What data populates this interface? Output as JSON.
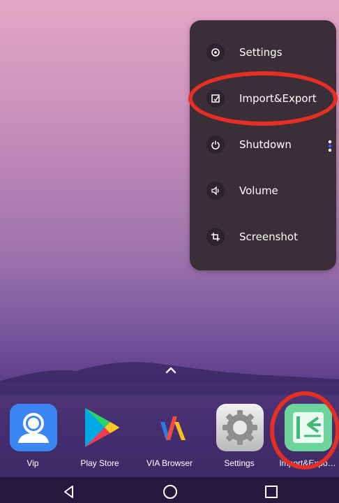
{
  "quick_menu": {
    "items": [
      {
        "label": "Settings",
        "icon": "gear-icon"
      },
      {
        "label": "Import&Export",
        "icon": "edit-box-icon"
      },
      {
        "label": "Shutdown",
        "icon": "power-icon"
      },
      {
        "label": "Volume",
        "icon": "speaker-icon"
      },
      {
        "label": "Screenshot",
        "icon": "crop-icon"
      }
    ]
  },
  "dock": {
    "apps": [
      {
        "label": "Vip",
        "icon": "vip-avatar-icon"
      },
      {
        "label": "Play Store",
        "icon": "play-store-icon"
      },
      {
        "label": "VIA Browser",
        "icon": "via-browser-icon"
      },
      {
        "label": "Settings",
        "icon": "settings-gear-icon"
      },
      {
        "label": "Import&Expo…",
        "icon": "import-export-icon"
      }
    ]
  },
  "navigation": {
    "back": "back-triangle-icon",
    "home": "home-circle-icon",
    "recents": "recents-square-icon"
  },
  "colors": {
    "menu_background": "#3b2e36",
    "annotation": "#e42f24",
    "import_export_green": "#54c98a"
  }
}
